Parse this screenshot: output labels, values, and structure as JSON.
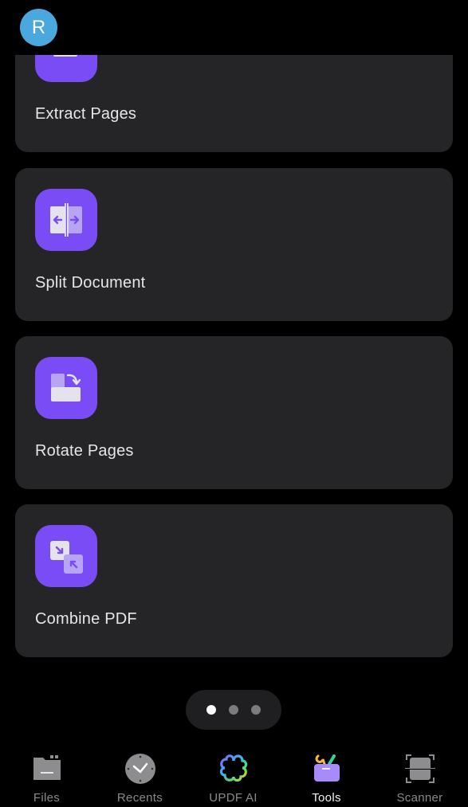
{
  "header": {
    "avatar_initial": "R"
  },
  "tools": [
    {
      "label": "Extract Pages",
      "icon": "extract-pages-icon"
    },
    {
      "label": "Split Document",
      "icon": "split-document-icon"
    },
    {
      "label": "Rotate Pages",
      "icon": "rotate-pages-icon"
    },
    {
      "label": "Combine PDF",
      "icon": "combine-pdf-icon"
    }
  ],
  "pager": {
    "pages": 3,
    "current": 1
  },
  "tabbar": {
    "items": [
      {
        "label": "Files",
        "icon": "folder-icon"
      },
      {
        "label": "Recents",
        "icon": "clock-icon"
      },
      {
        "label": "UPDF AI",
        "icon": "ai-flower-icon"
      },
      {
        "label": "Tools",
        "icon": "toolbox-icon",
        "active": true
      },
      {
        "label": "Scanner",
        "icon": "scanner-icon"
      }
    ]
  },
  "colors": {
    "accent": "#7a4cf5",
    "card": "#252527",
    "avatar": "#4aa8de"
  }
}
